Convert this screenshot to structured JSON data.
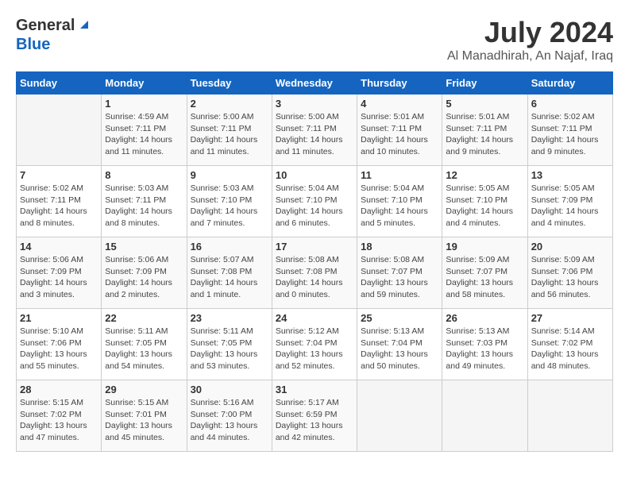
{
  "header": {
    "logo_general": "General",
    "logo_blue": "Blue",
    "month_title": "July 2024",
    "location": "Al Manadhirah, An Najaf, Iraq"
  },
  "calendar": {
    "days_of_week": [
      "Sunday",
      "Monday",
      "Tuesday",
      "Wednesday",
      "Thursday",
      "Friday",
      "Saturday"
    ],
    "weeks": [
      [
        {
          "day": "",
          "info": ""
        },
        {
          "day": "1",
          "info": "Sunrise: 4:59 AM\nSunset: 7:11 PM\nDaylight: 14 hours\nand 11 minutes."
        },
        {
          "day": "2",
          "info": "Sunrise: 5:00 AM\nSunset: 7:11 PM\nDaylight: 14 hours\nand 11 minutes."
        },
        {
          "day": "3",
          "info": "Sunrise: 5:00 AM\nSunset: 7:11 PM\nDaylight: 14 hours\nand 11 minutes."
        },
        {
          "day": "4",
          "info": "Sunrise: 5:01 AM\nSunset: 7:11 PM\nDaylight: 14 hours\nand 10 minutes."
        },
        {
          "day": "5",
          "info": "Sunrise: 5:01 AM\nSunset: 7:11 PM\nDaylight: 14 hours\nand 9 minutes."
        },
        {
          "day": "6",
          "info": "Sunrise: 5:02 AM\nSunset: 7:11 PM\nDaylight: 14 hours\nand 9 minutes."
        }
      ],
      [
        {
          "day": "7",
          "info": "Sunrise: 5:02 AM\nSunset: 7:11 PM\nDaylight: 14 hours\nand 8 minutes."
        },
        {
          "day": "8",
          "info": "Sunrise: 5:03 AM\nSunset: 7:11 PM\nDaylight: 14 hours\nand 8 minutes."
        },
        {
          "day": "9",
          "info": "Sunrise: 5:03 AM\nSunset: 7:10 PM\nDaylight: 14 hours\nand 7 minutes."
        },
        {
          "day": "10",
          "info": "Sunrise: 5:04 AM\nSunset: 7:10 PM\nDaylight: 14 hours\nand 6 minutes."
        },
        {
          "day": "11",
          "info": "Sunrise: 5:04 AM\nSunset: 7:10 PM\nDaylight: 14 hours\nand 5 minutes."
        },
        {
          "day": "12",
          "info": "Sunrise: 5:05 AM\nSunset: 7:10 PM\nDaylight: 14 hours\nand 4 minutes."
        },
        {
          "day": "13",
          "info": "Sunrise: 5:05 AM\nSunset: 7:09 PM\nDaylight: 14 hours\nand 4 minutes."
        }
      ],
      [
        {
          "day": "14",
          "info": "Sunrise: 5:06 AM\nSunset: 7:09 PM\nDaylight: 14 hours\nand 3 minutes."
        },
        {
          "day": "15",
          "info": "Sunrise: 5:06 AM\nSunset: 7:09 PM\nDaylight: 14 hours\nand 2 minutes."
        },
        {
          "day": "16",
          "info": "Sunrise: 5:07 AM\nSunset: 7:08 PM\nDaylight: 14 hours\nand 1 minute."
        },
        {
          "day": "17",
          "info": "Sunrise: 5:08 AM\nSunset: 7:08 PM\nDaylight: 14 hours\nand 0 minutes."
        },
        {
          "day": "18",
          "info": "Sunrise: 5:08 AM\nSunset: 7:07 PM\nDaylight: 13 hours\nand 59 minutes."
        },
        {
          "day": "19",
          "info": "Sunrise: 5:09 AM\nSunset: 7:07 PM\nDaylight: 13 hours\nand 58 minutes."
        },
        {
          "day": "20",
          "info": "Sunrise: 5:09 AM\nSunset: 7:06 PM\nDaylight: 13 hours\nand 56 minutes."
        }
      ],
      [
        {
          "day": "21",
          "info": "Sunrise: 5:10 AM\nSunset: 7:06 PM\nDaylight: 13 hours\nand 55 minutes."
        },
        {
          "day": "22",
          "info": "Sunrise: 5:11 AM\nSunset: 7:05 PM\nDaylight: 13 hours\nand 54 minutes."
        },
        {
          "day": "23",
          "info": "Sunrise: 5:11 AM\nSunset: 7:05 PM\nDaylight: 13 hours\nand 53 minutes."
        },
        {
          "day": "24",
          "info": "Sunrise: 5:12 AM\nSunset: 7:04 PM\nDaylight: 13 hours\nand 52 minutes."
        },
        {
          "day": "25",
          "info": "Sunrise: 5:13 AM\nSunset: 7:04 PM\nDaylight: 13 hours\nand 50 minutes."
        },
        {
          "day": "26",
          "info": "Sunrise: 5:13 AM\nSunset: 7:03 PM\nDaylight: 13 hours\nand 49 minutes."
        },
        {
          "day": "27",
          "info": "Sunrise: 5:14 AM\nSunset: 7:02 PM\nDaylight: 13 hours\nand 48 minutes."
        }
      ],
      [
        {
          "day": "28",
          "info": "Sunrise: 5:15 AM\nSunset: 7:02 PM\nDaylight: 13 hours\nand 47 minutes."
        },
        {
          "day": "29",
          "info": "Sunrise: 5:15 AM\nSunset: 7:01 PM\nDaylight: 13 hours\nand 45 minutes."
        },
        {
          "day": "30",
          "info": "Sunrise: 5:16 AM\nSunset: 7:00 PM\nDaylight: 13 hours\nand 44 minutes."
        },
        {
          "day": "31",
          "info": "Sunrise: 5:17 AM\nSunset: 6:59 PM\nDaylight: 13 hours\nand 42 minutes."
        },
        {
          "day": "",
          "info": ""
        },
        {
          "day": "",
          "info": ""
        },
        {
          "day": "",
          "info": ""
        }
      ]
    ]
  }
}
